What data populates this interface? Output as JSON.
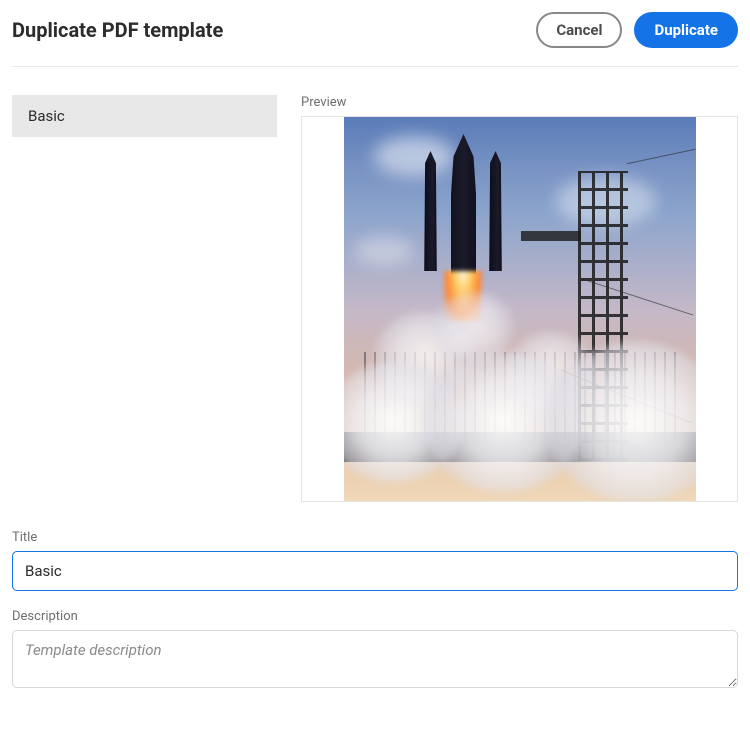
{
  "header": {
    "title": "Duplicate PDF template",
    "cancel_label": "Cancel",
    "duplicate_label": "Duplicate"
  },
  "sidebar": {
    "items": [
      {
        "label": "Basic"
      }
    ]
  },
  "preview": {
    "label": "Preview"
  },
  "form": {
    "title_label": "Title",
    "title_value": "Basic",
    "description_label": "Description",
    "description_value": "",
    "description_placeholder": "Template description"
  }
}
